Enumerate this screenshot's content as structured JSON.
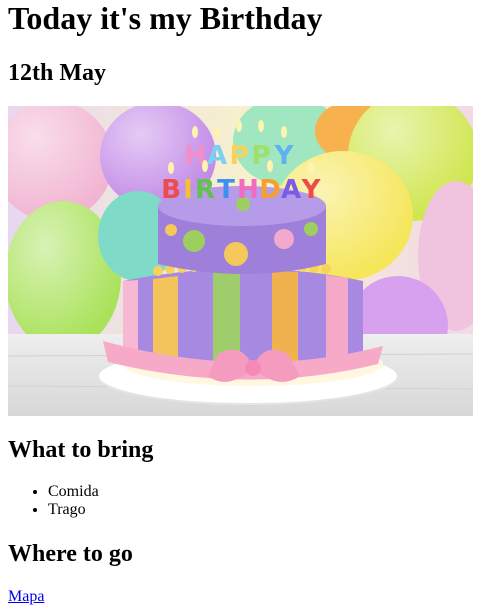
{
  "page": {
    "title": "Today it's my Birthday",
    "date": "12th May",
    "image": {
      "alt": "Birthday cake",
      "candle_text": "HAPPY BIRTHDAY"
    },
    "bring": {
      "heading": "What to bring",
      "items": [
        "Comida",
        "Trago"
      ]
    },
    "go": {
      "heading": "Where to go",
      "link_text": "Mapa"
    }
  }
}
